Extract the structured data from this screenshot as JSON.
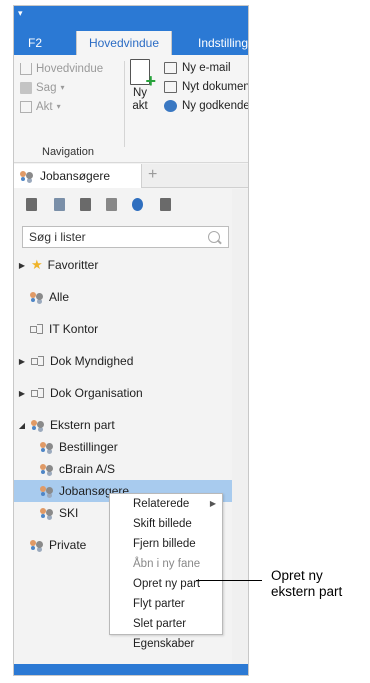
{
  "window": {
    "quick_access_glyph": "▾"
  },
  "ribbon_tabs": [
    "F2",
    "Hovedvindue",
    "Indstillinger"
  ],
  "ribbon": {
    "navigation": {
      "items": [
        "Hovedvindue",
        "Sag",
        "Akt"
      ],
      "group_label": "Navigation"
    },
    "new_act": {
      "label_line1": "Ny",
      "label_line2": "akt"
    },
    "small_buttons": [
      "Ny e-mail",
      "Nyt dokument",
      "Ny godkendelse"
    ]
  },
  "panel": {
    "tab_label": "Jobansøgere",
    "add_tab_glyph": "+"
  },
  "search": {
    "placeholder": "Søg i lister"
  },
  "tree": {
    "favorites": "Favoritter",
    "all": "Alle",
    "it_kontor": "IT Kontor",
    "dok_myndighed": "Dok Myndighed",
    "dok_organisation": "Dok Organisation",
    "ekstern_part": "Ekstern part",
    "children": [
      "Bestillinger",
      "cBrain A/S",
      "Jobansøgere",
      "SKI"
    ],
    "private": "Private"
  },
  "context_menu": {
    "items": [
      "Relaterede",
      "Skift billede",
      "Fjern billede",
      "Åbn i ny fane",
      "Opret ny part",
      "Flyt parter",
      "Slet parter",
      "Egenskaber"
    ],
    "disabled_item": "Åbn i ny fane"
  },
  "callout": {
    "line1": "Opret ny",
    "line2": "ekstern part"
  },
  "colors": {
    "accent": "#2b79d4",
    "selection": "#a8cbee"
  }
}
